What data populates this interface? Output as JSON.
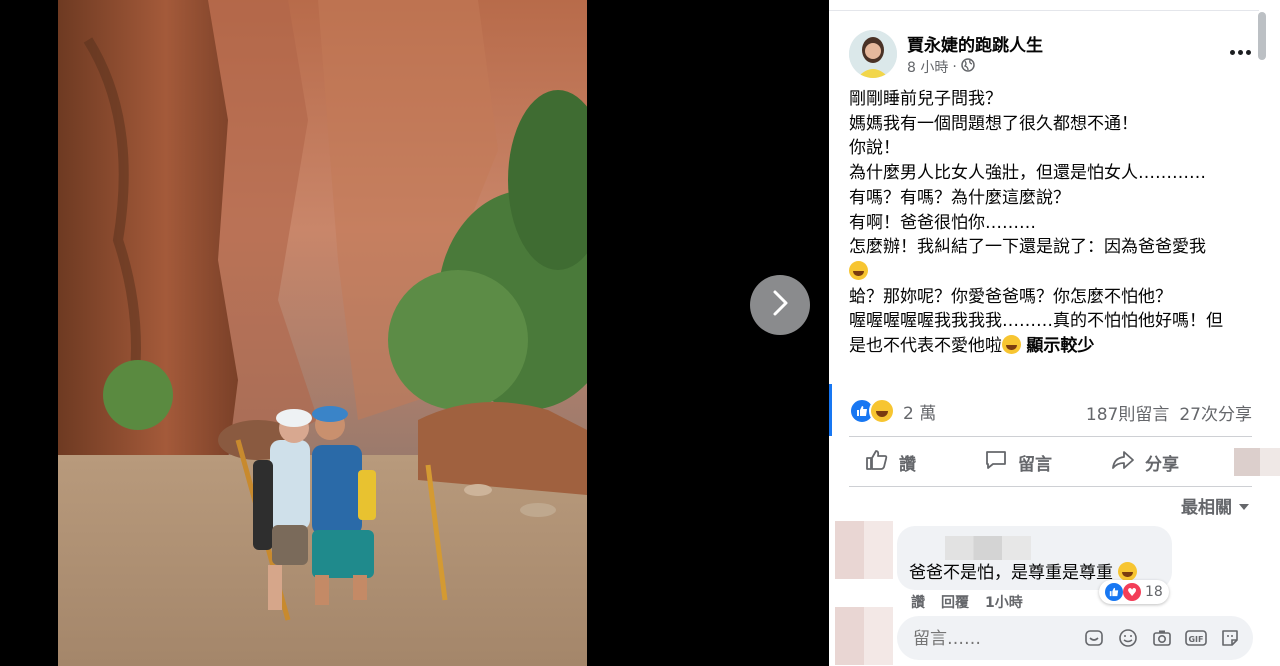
{
  "post": {
    "page_name": "賈永婕的跑跳人生",
    "time": "8 小時",
    "separator": "·",
    "body_lines": [
      "剛剛睡前兒子問我？",
      "媽媽我有一個問題想了很久都想不通！",
      "你說！",
      "為什麼男人比女人強壯，但還是怕女人…………",
      "有嗎？有嗎？為什麼這麼說？",
      "有啊！爸爸很怕你………",
      "怎麼辦！我糾結了一下還是說了：因為爸爸愛我",
      "蛤？那妳呢？你愛爸爸嗎？你怎麼不怕他？",
      "喔喔喔喔喔我我我我………真的不怕怕他好嗎！但",
      "是也不代表不愛他啦"
    ],
    "see_less": "顯示較少",
    "reaction_count": "2 萬",
    "comment_count": "187則留言",
    "share_count": "27次分享"
  },
  "actions": {
    "like": "讚",
    "comment": "留言",
    "share": "分享"
  },
  "comments": {
    "sort_label": "最相關",
    "first": {
      "text": "爸爸不是怕，是尊重是尊重",
      "reaction_count": "18",
      "like_label": "讚",
      "reply_label": "回覆",
      "time": "1小時"
    },
    "composer_placeholder": "留言……"
  },
  "icons": {
    "next": "chevron-right-icon",
    "more": "more-dots-icon",
    "globe": "globe-icon",
    "like_action": "thumbs-up-icon",
    "comment_action": "speech-bubble-icon",
    "share_action": "share-arrow-icon",
    "sort": "caret-down-icon",
    "composer": [
      "sticker-icon",
      "emoji-icon",
      "camera-icon",
      "gif-icon",
      "sticker-note-icon"
    ]
  },
  "colors": {
    "accent": "#1877f2",
    "secondary_text": "#65676b",
    "love": "#f33e58"
  }
}
